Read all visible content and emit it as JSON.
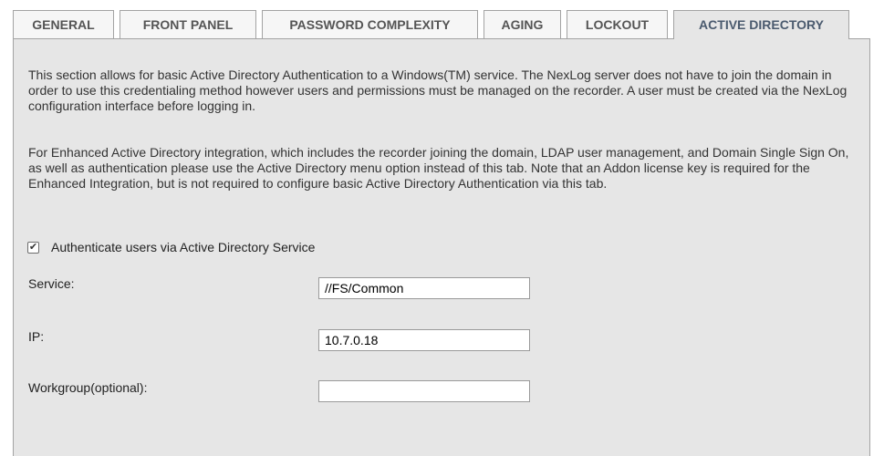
{
  "tabs": [
    {
      "label": "GENERAL",
      "active": false
    },
    {
      "label": "FRONT PANEL",
      "active": false
    },
    {
      "label": "PASSWORD COMPLEXITY",
      "active": false
    },
    {
      "label": "AGING",
      "active": false
    },
    {
      "label": "LOCKOUT",
      "active": false
    },
    {
      "label": "ACTIVE DIRECTORY",
      "active": true
    }
  ],
  "panel": {
    "intro": "This section allows for basic Active Directory Authentication to a Windows(TM) service. The NexLog server does not have to join the domain in order to use this credentialing method however users and permissions must be managed on the recorder. A user must be created via the NexLog configuration interface before logging in.",
    "enhanced_note": "For Enhanced Active Directory integration, which includes the recorder joining the domain, LDAP user management, and Domain Single Sign On, as well as authentication please use the Active Directory menu option instead of this tab. Note that an Addon license key is required for the Enhanced Integration, but is not required to configure basic Active Directory Authentication via this tab.",
    "authenticate": {
      "label": "Authenticate users via Active Directory Service",
      "checked": true,
      "check_glyph": "✔"
    },
    "fields": {
      "service": {
        "label": "Service:",
        "value": "//FS/Common"
      },
      "ip": {
        "label": "IP:",
        "value": "10.7.0.18"
      },
      "workgroup": {
        "label": "Workgroup(optional):",
        "value": ""
      }
    }
  },
  "colors": {
    "panel_background": "#e6e6e6",
    "tab_background": "#f6f6f6",
    "active_tab_text": "#4a5a6e",
    "border": "#a3a3a3"
  }
}
